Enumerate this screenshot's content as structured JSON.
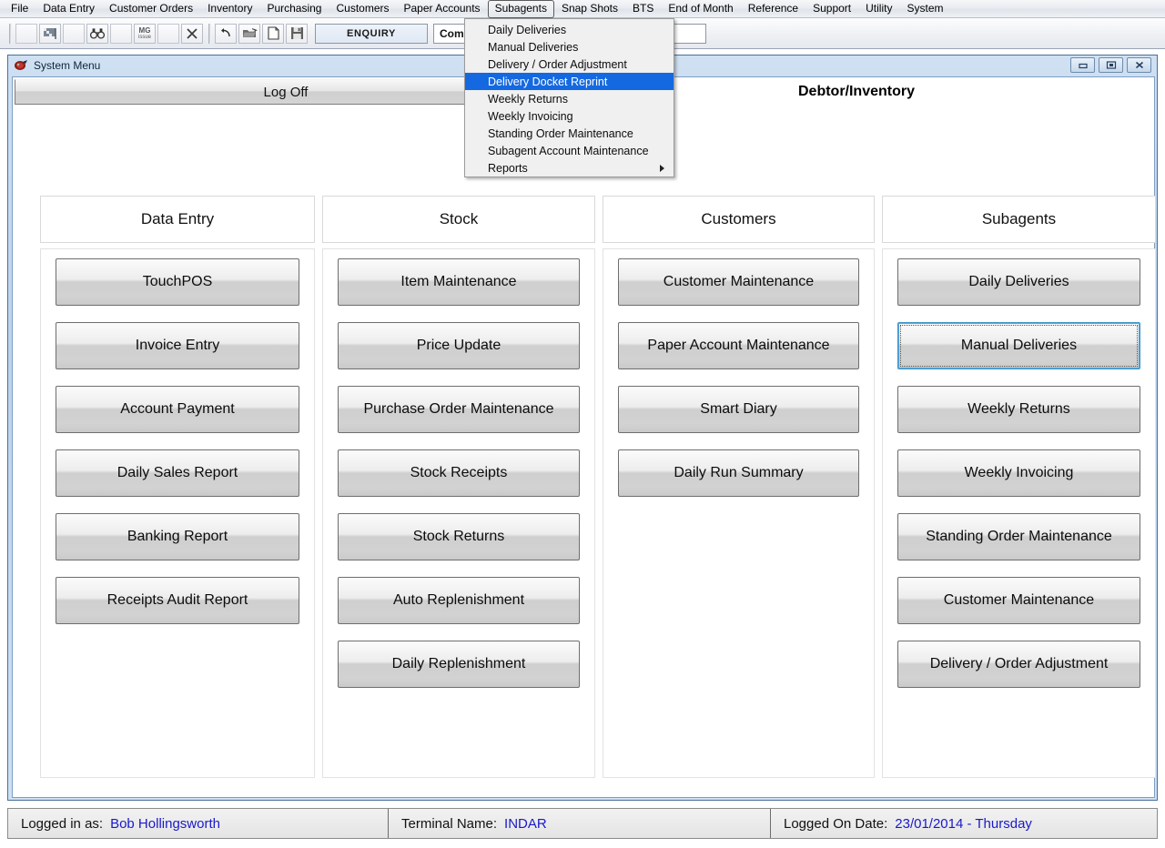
{
  "menubar": {
    "items": [
      {
        "label": "File",
        "active": false
      },
      {
        "label": "Data Entry",
        "active": false
      },
      {
        "label": "Customer Orders",
        "active": false
      },
      {
        "label": "Inventory",
        "active": false
      },
      {
        "label": "Purchasing",
        "active": false
      },
      {
        "label": "Customers",
        "active": false
      },
      {
        "label": "Paper Accounts",
        "active": false
      },
      {
        "label": "Subagents",
        "active": true
      },
      {
        "label": "Snap Shots",
        "active": false
      },
      {
        "label": "BTS",
        "active": false
      },
      {
        "label": "End of Month",
        "active": false
      },
      {
        "label": "Reference",
        "active": false
      },
      {
        "label": "Support",
        "active": false
      },
      {
        "label": "Utility",
        "active": false
      },
      {
        "label": "System",
        "active": false
      }
    ]
  },
  "toolbar": {
    "icons": [
      {
        "name": "blank-1-icon",
        "glyph": ""
      },
      {
        "name": "flag-icon",
        "glyph": "flag"
      },
      {
        "name": "blank-2-icon",
        "glyph": ""
      },
      {
        "name": "binoculars-icon",
        "glyph": "binoculars"
      },
      {
        "name": "blank-3-icon",
        "glyph": ""
      },
      {
        "name": "mg-issue-icon",
        "glyph": "mgissue"
      },
      {
        "name": "blank-4-icon",
        "glyph": ""
      },
      {
        "name": "close-x-icon",
        "glyph": "x"
      },
      {
        "name": "undo-icon",
        "glyph": "undo"
      },
      {
        "name": "open-folder-icon",
        "glyph": "folder"
      },
      {
        "name": "new-document-icon",
        "glyph": "page"
      },
      {
        "name": "save-disk-icon",
        "glyph": "save"
      }
    ],
    "enquiry_label": "ENQUIRY",
    "company_value": "Computerlink De"
  },
  "dropdown": {
    "owner": "Subagents",
    "items": [
      {
        "label": "Daily Deliveries",
        "selected": false,
        "submenu": false
      },
      {
        "label": "Manual Deliveries",
        "selected": false,
        "submenu": false
      },
      {
        "label": "Delivery / Order Adjustment",
        "selected": false,
        "submenu": false
      },
      {
        "label": "Delivery Docket Reprint",
        "selected": true,
        "submenu": false
      },
      {
        "label": "Weekly Returns",
        "selected": false,
        "submenu": false
      },
      {
        "label": "Weekly Invoicing",
        "selected": false,
        "submenu": false
      },
      {
        "label": "Standing Order Maintenance",
        "selected": false,
        "submenu": false
      },
      {
        "label": "Subagent Account Maintenance",
        "selected": false,
        "submenu": false
      },
      {
        "label": "Reports",
        "selected": false,
        "submenu": true
      }
    ],
    "highlight_color": "#1569e0"
  },
  "window": {
    "title": "System Menu",
    "icon_name": "app-icon",
    "controls": [
      {
        "name": "minimize-button",
        "glyph": "minimize"
      },
      {
        "name": "restore-button",
        "glyph": "restore"
      },
      {
        "name": "close-button",
        "glyph": "close"
      }
    ]
  },
  "header": {
    "logoff_label": "Log Off",
    "section_title": "Debtor/Inventory"
  },
  "columns": [
    {
      "heading": "Data Entry",
      "buttons": [
        {
          "label": "TouchPOS",
          "focused": false
        },
        {
          "label": "Invoice Entry",
          "focused": false
        },
        {
          "label": "Account Payment",
          "focused": false
        },
        {
          "label": "Daily Sales Report",
          "focused": false
        },
        {
          "label": "Banking Report",
          "focused": false
        },
        {
          "label": "Receipts Audit Report",
          "focused": false
        }
      ]
    },
    {
      "heading": "Stock",
      "buttons": [
        {
          "label": "Item Maintenance",
          "focused": false
        },
        {
          "label": "Price Update",
          "focused": false
        },
        {
          "label": "Purchase Order Maintenance",
          "focused": false
        },
        {
          "label": "Stock Receipts",
          "focused": false
        },
        {
          "label": "Stock Returns",
          "focused": false
        },
        {
          "label": "Auto Replenishment",
          "focused": false
        },
        {
          "label": "Daily Replenishment",
          "focused": false
        }
      ]
    },
    {
      "heading": "Customers",
      "buttons": [
        {
          "label": "Customer Maintenance",
          "focused": false
        },
        {
          "label": "Paper Account Maintenance",
          "focused": false
        },
        {
          "label": "Smart Diary",
          "focused": false
        },
        {
          "label": "Daily Run Summary",
          "focused": false
        }
      ]
    },
    {
      "heading": "Subagents",
      "buttons": [
        {
          "label": "Daily Deliveries",
          "focused": false
        },
        {
          "label": "Manual Deliveries",
          "focused": true
        },
        {
          "label": "Weekly Returns",
          "focused": false
        },
        {
          "label": "Weekly Invoicing",
          "focused": false
        },
        {
          "label": "Standing Order Maintenance",
          "focused": false
        },
        {
          "label": "Customer Maintenance",
          "focused": false
        },
        {
          "label": "Delivery / Order Adjustment",
          "focused": false
        }
      ]
    }
  ],
  "statusbar": {
    "user_label": "Logged in as:",
    "user_value": "Bob Hollingsworth",
    "terminal_label": "Terminal Name:",
    "terminal_value": "INDAR",
    "date_label": "Logged On Date:",
    "date_value": "23/01/2014 - Thursday",
    "value_color": "#1919c8"
  }
}
